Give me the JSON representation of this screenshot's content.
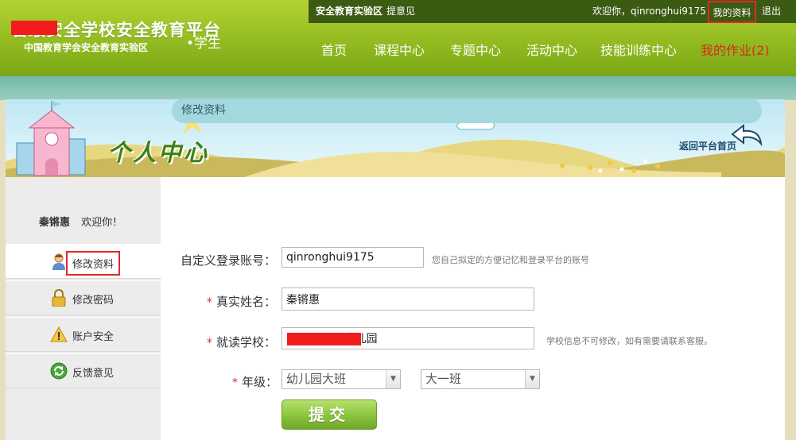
{
  "header": {
    "logo_title": "省级安全学校安全教育平台",
    "logo_subtitle": "中国教育学会安全教育实验区",
    "role_label": "•学生",
    "topbar": {
      "zone_label": "安全教育实验区",
      "feedback_link": "提意见",
      "welcome_text": "欢迎你，qinronghui9175",
      "profile_link": "我的资料",
      "logout_link": "退出"
    },
    "nav": [
      "首页",
      "课程中心",
      "专题中心",
      "活动中心",
      "技能训练中心",
      "我的作业(2)"
    ]
  },
  "banner": {
    "title": "个人中心",
    "back_link": "返回平台首页"
  },
  "sidebar": {
    "user_name": "秦锵惠",
    "greeting": "欢迎你！",
    "items": [
      {
        "label": "修改资料",
        "icon": "user-icon"
      },
      {
        "label": "修改密码",
        "icon": "lock-icon"
      },
      {
        "label": "账户安全",
        "icon": "warning-icon"
      },
      {
        "label": "反馈意见",
        "icon": "refresh-icon"
      }
    ]
  },
  "form": {
    "section_title": "修改资料",
    "account": {
      "label": "自定义登录账号：",
      "value": "qinronghui9175",
      "hint": "您自己拟定的方便记忆和登录平台的账号"
    },
    "real_name": {
      "label": "真实姓名：",
      "value": "秦锵惠"
    },
    "school": {
      "label": "就读学校：",
      "value": "1        中心幼儿园",
      "hint": "学校信息不可修改，如有需要请联系客服。"
    },
    "grade": {
      "label": "年级：",
      "grade_value": "幼儿园大班",
      "class_value": "大一班"
    },
    "required_mark": "*",
    "submit_label": "提交"
  },
  "colors": {
    "header_green": "#8fb91f",
    "topbar_dark": "#3b5a12",
    "section_bar": "#a3d8de",
    "highlight_red": "#e02828",
    "homework_red": "#d82a1a"
  }
}
